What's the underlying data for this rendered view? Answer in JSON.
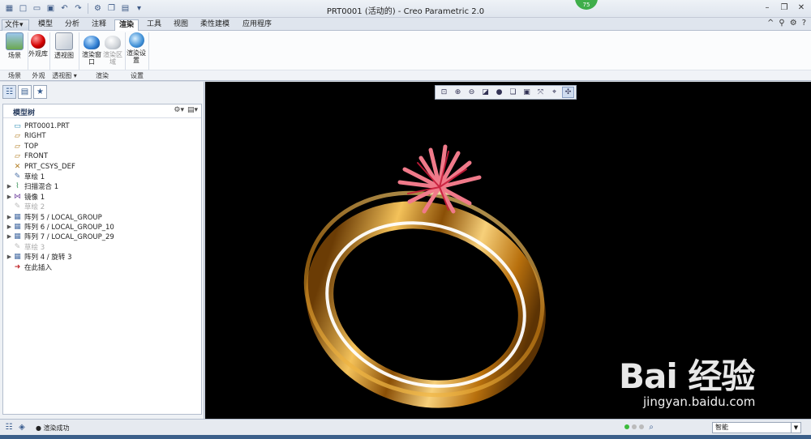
{
  "window": {
    "title": "PRT0001 (活动的) - Creo Parametric 2.0",
    "badge": "75"
  },
  "tabs": [
    "文件",
    "模型",
    "分析",
    "注释",
    "渲染",
    "工具",
    "视图",
    "柔性建模",
    "应用程序"
  ],
  "active_tab": "渲染",
  "ribbon": {
    "buttons": [
      {
        "label": "场景"
      },
      {
        "label": "外观库"
      },
      {
        "label": "透视图"
      },
      {
        "label": "渲染窗口"
      },
      {
        "label": "渲染区域"
      },
      {
        "label": "渲染设置"
      }
    ],
    "groups": [
      "场景",
      "外观",
      "透视图",
      "渲染",
      "设置"
    ]
  },
  "model_tree": {
    "header": "模型树",
    "nodes": [
      {
        "label": "PRT0001.PRT",
        "icon": "part-icon",
        "expandable": false,
        "dim": false
      },
      {
        "label": "RIGHT",
        "icon": "datum-plane-icon",
        "expandable": false,
        "dim": false
      },
      {
        "label": "TOP",
        "icon": "datum-plane-icon",
        "expandable": false,
        "dim": false
      },
      {
        "label": "FRONT",
        "icon": "datum-plane-icon",
        "expandable": false,
        "dim": false
      },
      {
        "label": "PRT_CSYS_DEF",
        "icon": "csys-icon",
        "expandable": false,
        "dim": false
      },
      {
        "label": "草绘 1",
        "icon": "sketch-icon",
        "expandable": false,
        "dim": false
      },
      {
        "label": "扫描混合 1",
        "icon": "sweep-blend-icon",
        "expandable": true,
        "dim": false
      },
      {
        "label": "镜像 1",
        "icon": "mirror-icon",
        "expandable": true,
        "dim": false
      },
      {
        "label": "草绘 2",
        "icon": "sketch-icon",
        "expandable": false,
        "dim": true
      },
      {
        "label": "阵列 5 / LOCAL_GROUP",
        "icon": "pattern-icon",
        "expandable": true,
        "dim": false
      },
      {
        "label": "阵列 6 / LOCAL_GROUP_10",
        "icon": "pattern-icon",
        "expandable": true,
        "dim": false
      },
      {
        "label": "阵列 7 / LOCAL_GROUP_29",
        "icon": "pattern-icon",
        "expandable": true,
        "dim": false
      },
      {
        "label": "草绘 3",
        "icon": "sketch-icon",
        "expandable": false,
        "dim": true
      },
      {
        "label": "阵列 4 / 旋转 3",
        "icon": "pattern-icon",
        "expandable": true,
        "dim": false
      },
      {
        "label": "在此插入",
        "icon": "insert-here-icon",
        "expandable": false,
        "dim": false
      }
    ]
  },
  "status": {
    "message": "渲染成功",
    "filter_value": "智能"
  },
  "watermark": {
    "brand": "Bai 经验",
    "url": "jingyan.baidu.com"
  },
  "colors": {
    "viewport_bg": "#000000",
    "ring_gold": "#d99a1f",
    "petals": "#e0405a"
  }
}
